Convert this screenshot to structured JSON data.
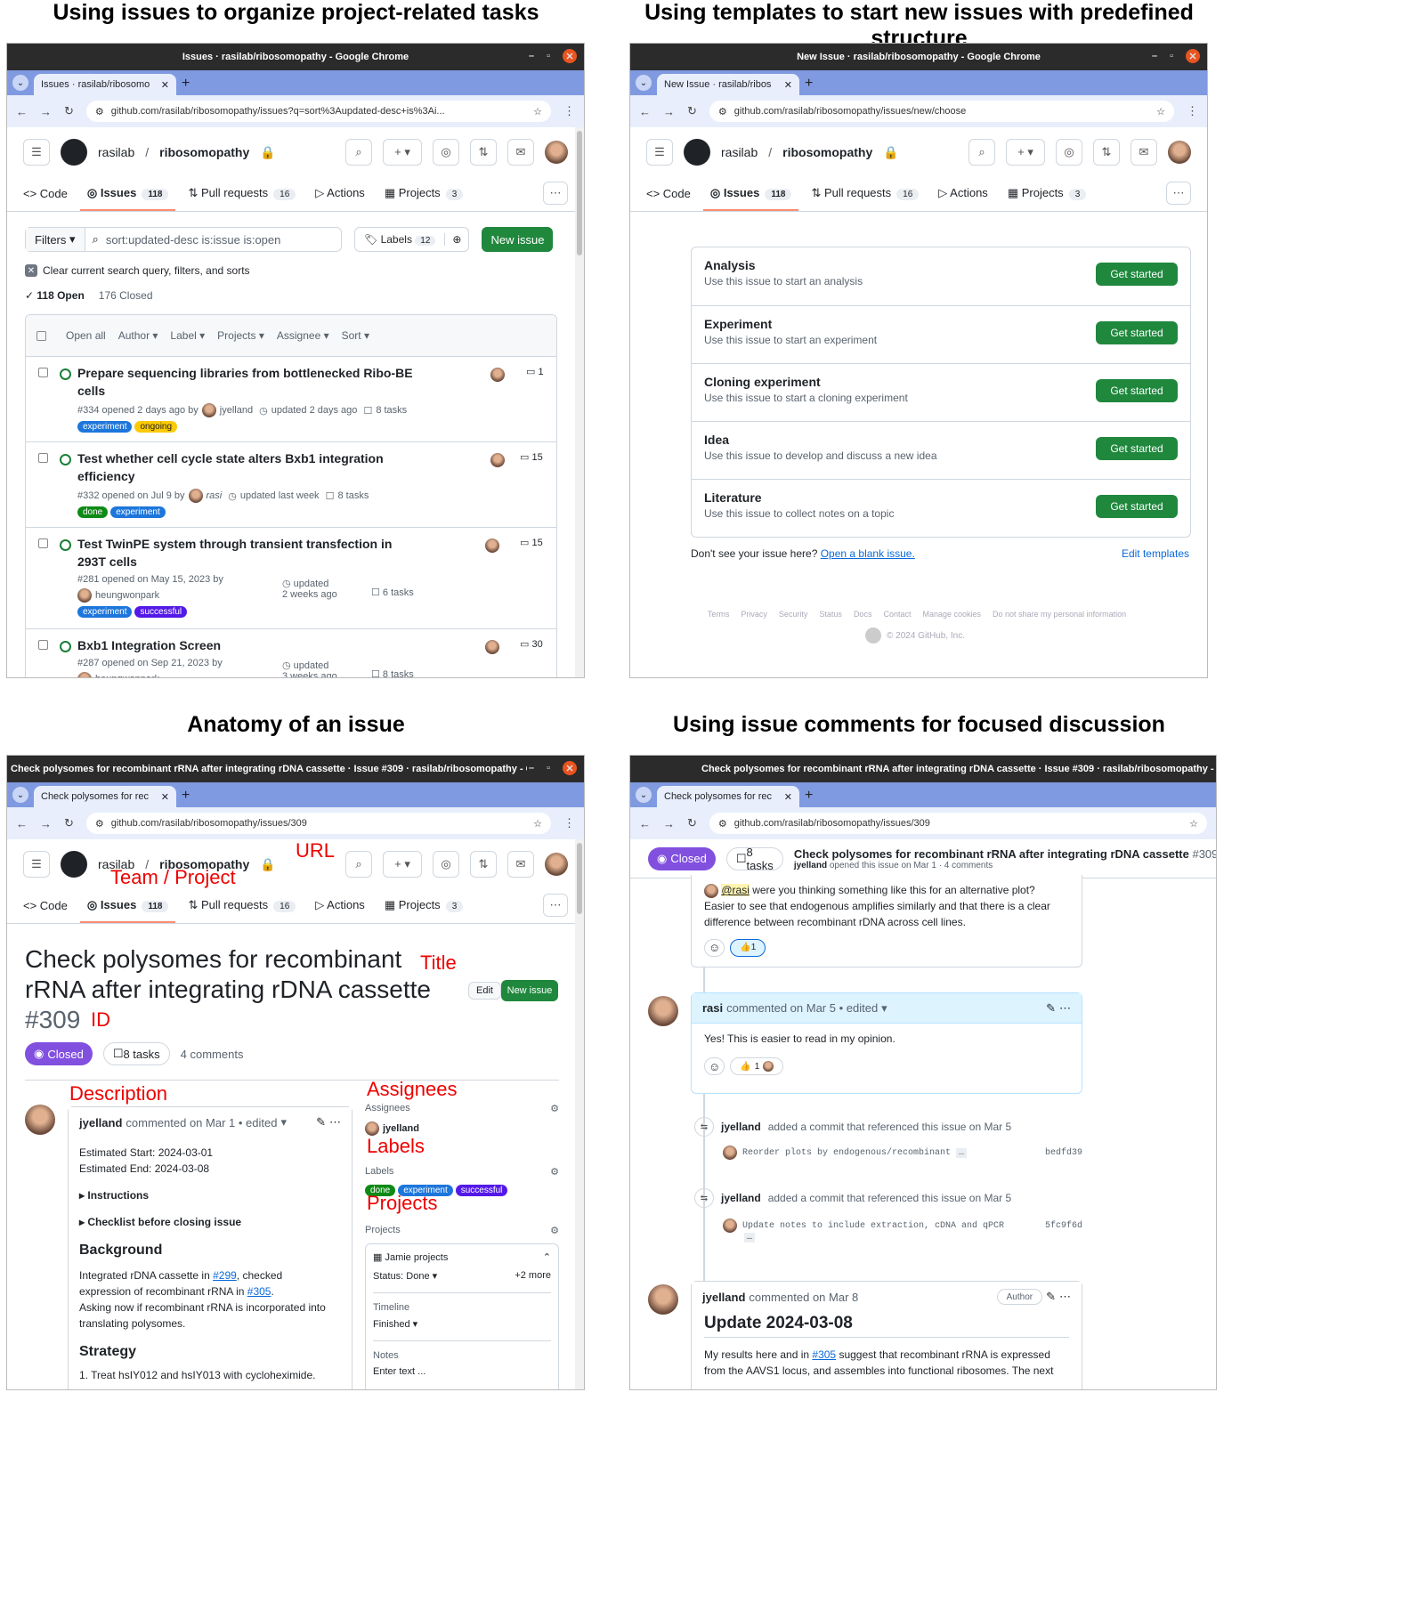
{
  "panels": {
    "p1_title": "Using issues to organize project-related tasks",
    "p2_title": "Using templates to start new issues with predefined structure",
    "p3_title": "Anatomy of an issue",
    "p4_title": "Using issue comments for focused discussion"
  },
  "common": {
    "owner": "rasilab",
    "repo": "ribosomopathy",
    "nav": [
      "Code",
      "Issues",
      "Pull requests",
      "Actions",
      "Projects"
    ],
    "counts": {
      "issues": "118",
      "prs": "16",
      "projects": "3"
    },
    "ctrl_min": "–",
    "ctrl_max": "▫",
    "ctrl_close": "✕",
    "tab_close": "✕",
    "tab_plus": "+",
    "tab_drop": "⌄",
    "back": "←",
    "fwd": "→",
    "reload": "↻"
  },
  "w1": {
    "title": "Issues · rasilab/ribosomopathy - Google Chrome",
    "tab": "Issues · rasilab/ribosomo",
    "url": "github.com/rasilab/ribosomopathy/issues?q=sort%3Aupdated-desc+is%3Ai...",
    "filters": "Filters",
    "search": "sort:updated-desc is:issue is:open",
    "labels": "Labels",
    "labels_count": "12",
    "new_issue": "New issue",
    "clear": "Clear current search query, filters, and sorts",
    "open": "118 Open",
    "closed": "176 Closed",
    "table_head": [
      "Open all",
      "Author",
      "Label",
      "Projects",
      "Assignee",
      "Sort"
    ],
    "issues": [
      {
        "title": "Prepare sequencing libraries from bottlenecked Ribo-BE cells",
        "meta": "#334 opened 2 days ago by",
        "user": "jyelland",
        "updated": "updated 2 days ago",
        "tasks": "8 tasks",
        "comments": "1",
        "labels": [
          "experiment",
          "ongoing"
        ]
      },
      {
        "title": "Test whether cell cycle state alters Bxb1 integration efficiency",
        "meta": "#332 opened on Jul 9 by",
        "user": "rasi",
        "updated": "updated last week",
        "tasks": "8 tasks",
        "comments": "15",
        "labels": [
          "done",
          "experiment"
        ]
      },
      {
        "title": "Test TwinPE system through transient transfection in 293T cells",
        "meta": "#281 opened on May 15, 2023 by",
        "user": "heungwonpark",
        "updated": "updated",
        "updated2": "2 weeks ago",
        "tasks": "6 tasks",
        "comments": "15",
        "labels": [
          "experiment",
          "successful"
        ]
      },
      {
        "title": "Bxb1 Integration Screen",
        "meta": "#287 opened on Sep 21, 2023 by",
        "user": "heungwonpark",
        "updated": "updated",
        "updated2": "3 weeks ago",
        "tasks": "8 tasks",
        "comments": "30"
      }
    ]
  },
  "w2": {
    "title": "New Issue · rasilab/ribosomopathy - Google Chrome",
    "tab": "New Issue · rasilab/ribos",
    "url": "github.com/rasilab/ribosomopathy/issues/new/choose",
    "templates": [
      {
        "name": "Analysis",
        "desc": "Use this issue to start an analysis"
      },
      {
        "name": "Experiment",
        "desc": "Use this issue to start an experiment"
      },
      {
        "name": "Cloning experiment",
        "desc": "Use this issue to start a cloning experiment"
      },
      {
        "name": "Idea",
        "desc": "Use this issue to develop and discuss a new idea"
      },
      {
        "name": "Literature",
        "desc": "Use this issue to collect notes on a topic"
      }
    ],
    "get_started": "Get started",
    "dont_see": "Don't see your issue here?",
    "blank": "Open a blank issue.",
    "edit_templates": "Edit templates",
    "footer": [
      "Terms",
      "Privacy",
      "Security",
      "Status",
      "Docs",
      "Contact",
      "Manage cookies",
      "Do not share my personal information"
    ],
    "copyright": "© 2024 GitHub, Inc."
  },
  "w3": {
    "title": "Check polysomes for recombinant rRNA after integrating rDNA cassette · Issue #309 · rasilab/ribosomopathy - Google ...",
    "tab": "Check polysomes for rec",
    "url": "github.com/rasilab/ribosomopathy/issues/309",
    "heading1": "Check polysomes for recombinant",
    "heading2": "rRNA after integrating rDNA cassette",
    "number": "#309",
    "edit": "Edit",
    "new_issue": "New issue",
    "closed": "Closed",
    "tasks": "8 tasks",
    "comments": "4 comments",
    "comment_user": "jyelland",
    "comment_meta": "commented on Mar 1 • edited",
    "est_start": "Estimated Start: 2024-03-01",
    "est_end": "Estimated End: 2024-03-08",
    "instructions": "Instructions",
    "checklist": "Checklist before closing issue",
    "background": "Background",
    "bg1": "Integrated rDNA cassette in",
    "bg_link1": "#299",
    "bg2": ", checked",
    "bg3": "expression of recombinant rRNA in",
    "bg_link2": "#305",
    "bg4": ".",
    "bg5": "Asking now if recombinant rRNA is incorporated into",
    "bg6": "translating polysomes.",
    "strategy": "Strategy",
    "strategy1": "1. Treat hsIY012 and hsIY013 with cycloheximide.",
    "side_assignees": "Assignees",
    "assignee": "jyelland",
    "side_labels": "Labels",
    "labels": [
      "done",
      "experiment",
      "successful"
    ],
    "side_projects": "Projects",
    "project": "Jamie projects",
    "status": "Status: Done",
    "more": "+2 more",
    "timeline": "Timeline",
    "finished": "Finished",
    "notes": "Notes",
    "enter_text": "Enter text ...",
    "annot": {
      "url": "URL",
      "team": "Team / Project",
      "title": "Title",
      "id": "ID",
      "description": "Description",
      "assignees": "Assignees",
      "labels": "Labels",
      "projects": "Projects"
    }
  },
  "w4": {
    "title": "Check polysomes for recombinant rRNA after integrating rDNA cassette · Issue #309 · rasilab/ribosomopathy - Google C",
    "tab": "Check polysomes for rec",
    "url": "github.com/rasilab/ribosomopathy/issues/309",
    "closed": "Closed",
    "tasks": "8 tasks",
    "sticky_title": "Check polysomes for recombinant rRNA after integrating rDNA cassette",
    "sticky_num": "#309",
    "sticky_user": "jyelland",
    "sticky_meta": "opened this issue on Mar 1 · 4 comments",
    "c1_mention": "@rasi",
    "c1_line1": " were you thinking something like this for an alternative plot?",
    "c1_line2": "Easier to see that endogenous amplifies similarly and that there is a clear",
    "c1_line3": "difference between recombinant rDNA across cell lines.",
    "c1_reaction": "1",
    "c2_user": "rasi",
    "c2_meta": "commented on Mar 5 • edited",
    "c2_body": "Yes! This is easier to read in my opinion.",
    "c2_reaction": "1",
    "ev1_user": "jyelland",
    "ev1_text": "added a commit that referenced this issue on Mar 5",
    "ev1_commit": "Reorder plots by endogenous/recombinant",
    "ev1_hash": "bedfd39",
    "ev2_user": "jyelland",
    "ev2_text": "added a commit that referenced this issue on Mar 5",
    "ev2_commit": "Update notes to include extraction, cDNA and qPCR",
    "ev2_hash": "5fc9f6d",
    "ellipsis": "…",
    "c3_user": "jyelland",
    "c3_meta": "commented on Mar 8",
    "c3_badge": "Author",
    "c3_heading": "Update 2024-03-08",
    "c3_line1a": "My results here and in",
    "c3_link": "#305",
    "c3_line1b": " suggest that recombinant rRNA is expressed",
    "c3_line2": "from the AAVS1 locus, and assembles into functional ribosomes. The next"
  }
}
